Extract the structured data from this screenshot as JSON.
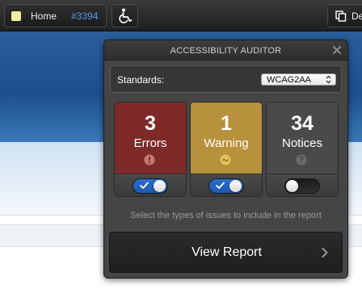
{
  "toolbar": {
    "home_label": "Home",
    "home_id": "#3394",
    "home_swatch_color": "#eef0a2",
    "accessibility_icon": "wheelchair-icon",
    "right_button_icon": "copy-icon",
    "right_button_label": "De"
  },
  "popup": {
    "title": "ACCESSIBILITY AUDITOR",
    "close_icon": "close-icon",
    "standards": {
      "label": "Standards:",
      "selected": "WCAG2AA"
    },
    "cards": [
      {
        "count": "3",
        "type": "Errors",
        "color": "#7e2a28",
        "icon": "error-icon",
        "enabled": true
      },
      {
        "count": "1",
        "type": "Warning",
        "color": "#b8913d",
        "icon": "warning-icon",
        "enabled": true
      },
      {
        "count": "34",
        "type": "Notices",
        "color": "#4a4a4a",
        "icon": "notice-icon",
        "enabled": false
      }
    ],
    "help_text": "Select the types of issues to include in the report",
    "view_report_label": "View Report"
  },
  "colors": {
    "accent_blue": "#2c6fd0",
    "link_blue": "#5a9ae6"
  }
}
